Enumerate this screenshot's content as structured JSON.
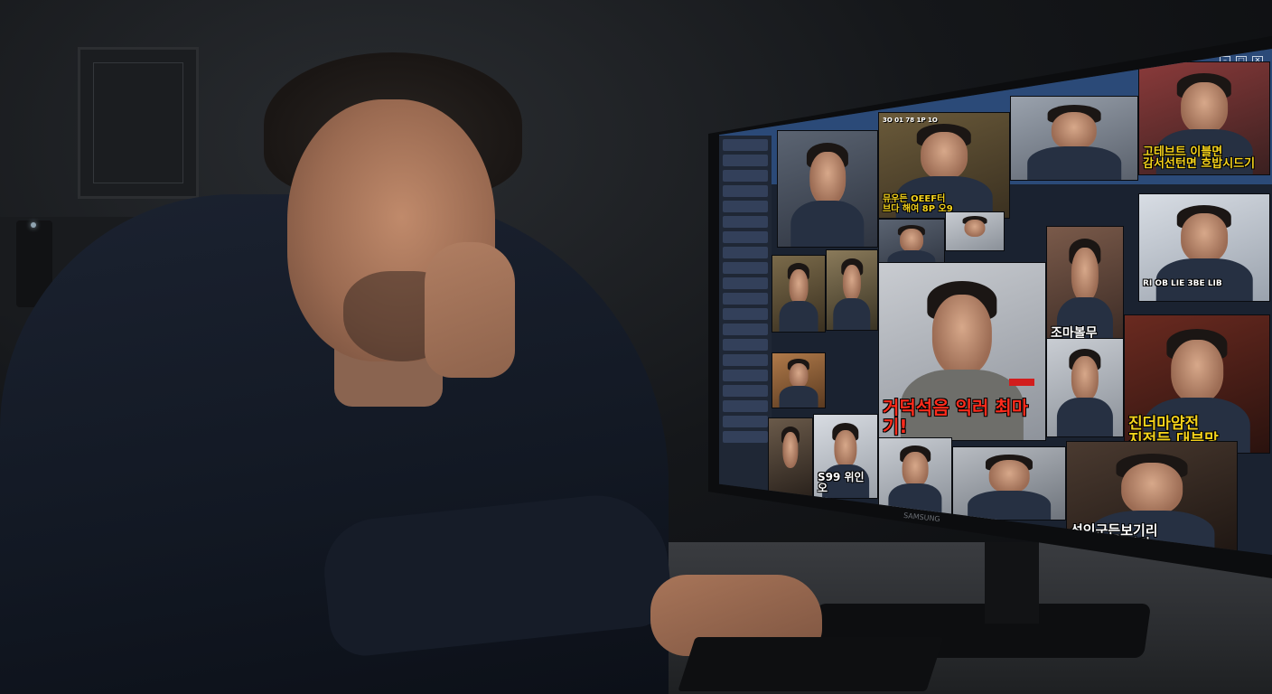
{
  "scene": {
    "description_role": "photo",
    "monitor_brand": "SAMSUNG"
  },
  "screen": {
    "window_controls": [
      "–",
      "□",
      "✕"
    ],
    "tiles": [
      {
        "id": "t1",
        "top_text": "3O 01 78 1P 1O",
        "caption": ""
      },
      {
        "id": "t2",
        "top_text": "",
        "caption": "뮤우든 OEEF터\n브다 해여 8P 오9"
      },
      {
        "id": "t3",
        "top_text": "",
        "caption": ""
      },
      {
        "id": "t4",
        "top_text": "",
        "caption": "고테브트 이블면\n감서선턴면 흐밥시드기"
      },
      {
        "id": "t5",
        "top_text": "",
        "caption": ""
      },
      {
        "id": "t6",
        "top_text": "",
        "caption": ""
      },
      {
        "id": "t7",
        "top_text": "",
        "caption": "RI OB LIE 3BE LIB"
      },
      {
        "id": "t8",
        "top_text": "",
        "caption": ""
      },
      {
        "id": "t9",
        "top_text": "",
        "caption": "조마볼무"
      },
      {
        "id": "t10",
        "top_text": "",
        "caption": "거덕석음 익러 최마기!"
      },
      {
        "id": "t11",
        "top_text": "",
        "caption": "진더마얌전\n지전든 대부망"
      },
      {
        "id": "t12",
        "top_text": "",
        "caption": ""
      },
      {
        "id": "t13",
        "top_text": "",
        "caption": ""
      },
      {
        "id": "t14",
        "top_text": "",
        "caption": "석인군든보기리\n미쟈가 부빈기"
      },
      {
        "id": "t15",
        "top_text": "",
        "caption": "S99 위인오"
      },
      {
        "id": "t16",
        "top_text": "",
        "caption": ""
      },
      {
        "id": "t17",
        "top_text": "",
        "caption": ""
      },
      {
        "id": "t18",
        "top_text": "",
        "caption": ""
      }
    ]
  },
  "colors": {
    "caption_yellow": "#f4d21c",
    "caption_red": "#ff2b1c",
    "window_blue": "#2b4a78"
  }
}
